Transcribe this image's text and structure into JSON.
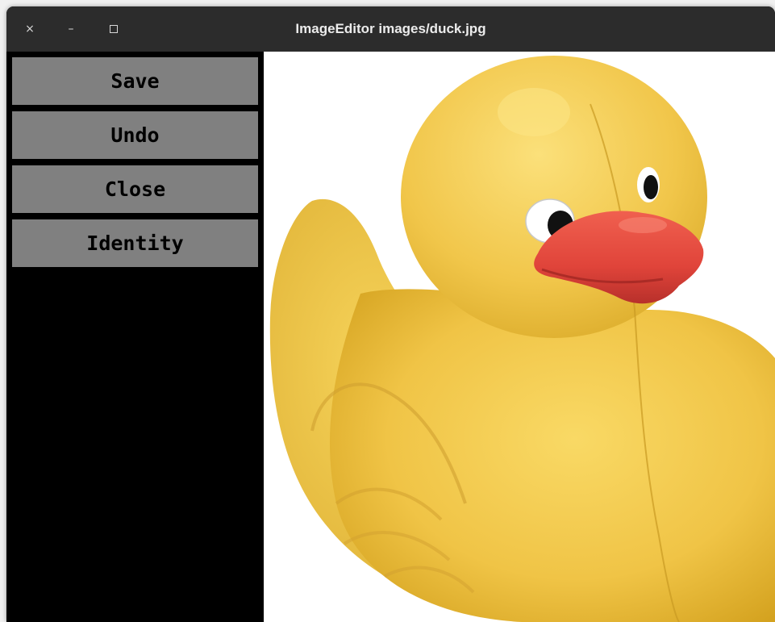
{
  "window": {
    "title": "ImageEditor images/duck.jpg",
    "controls": {
      "close_glyph": "×",
      "minimize_glyph": "–"
    }
  },
  "sidebar": {
    "buttons": [
      {
        "label": "Save"
      },
      {
        "label": "Undo"
      },
      {
        "label": "Close"
      },
      {
        "label": "Identity"
      }
    ]
  },
  "image": {
    "filename": "images/duck.jpg",
    "subject": "yellow rubber duck with red beak"
  },
  "colors": {
    "titlebar": "#2c2c2c",
    "sidebar_bg": "#000000",
    "button_bg": "#808080",
    "duck_yellow": "#f2c84b",
    "beak_red": "#e4463c"
  }
}
